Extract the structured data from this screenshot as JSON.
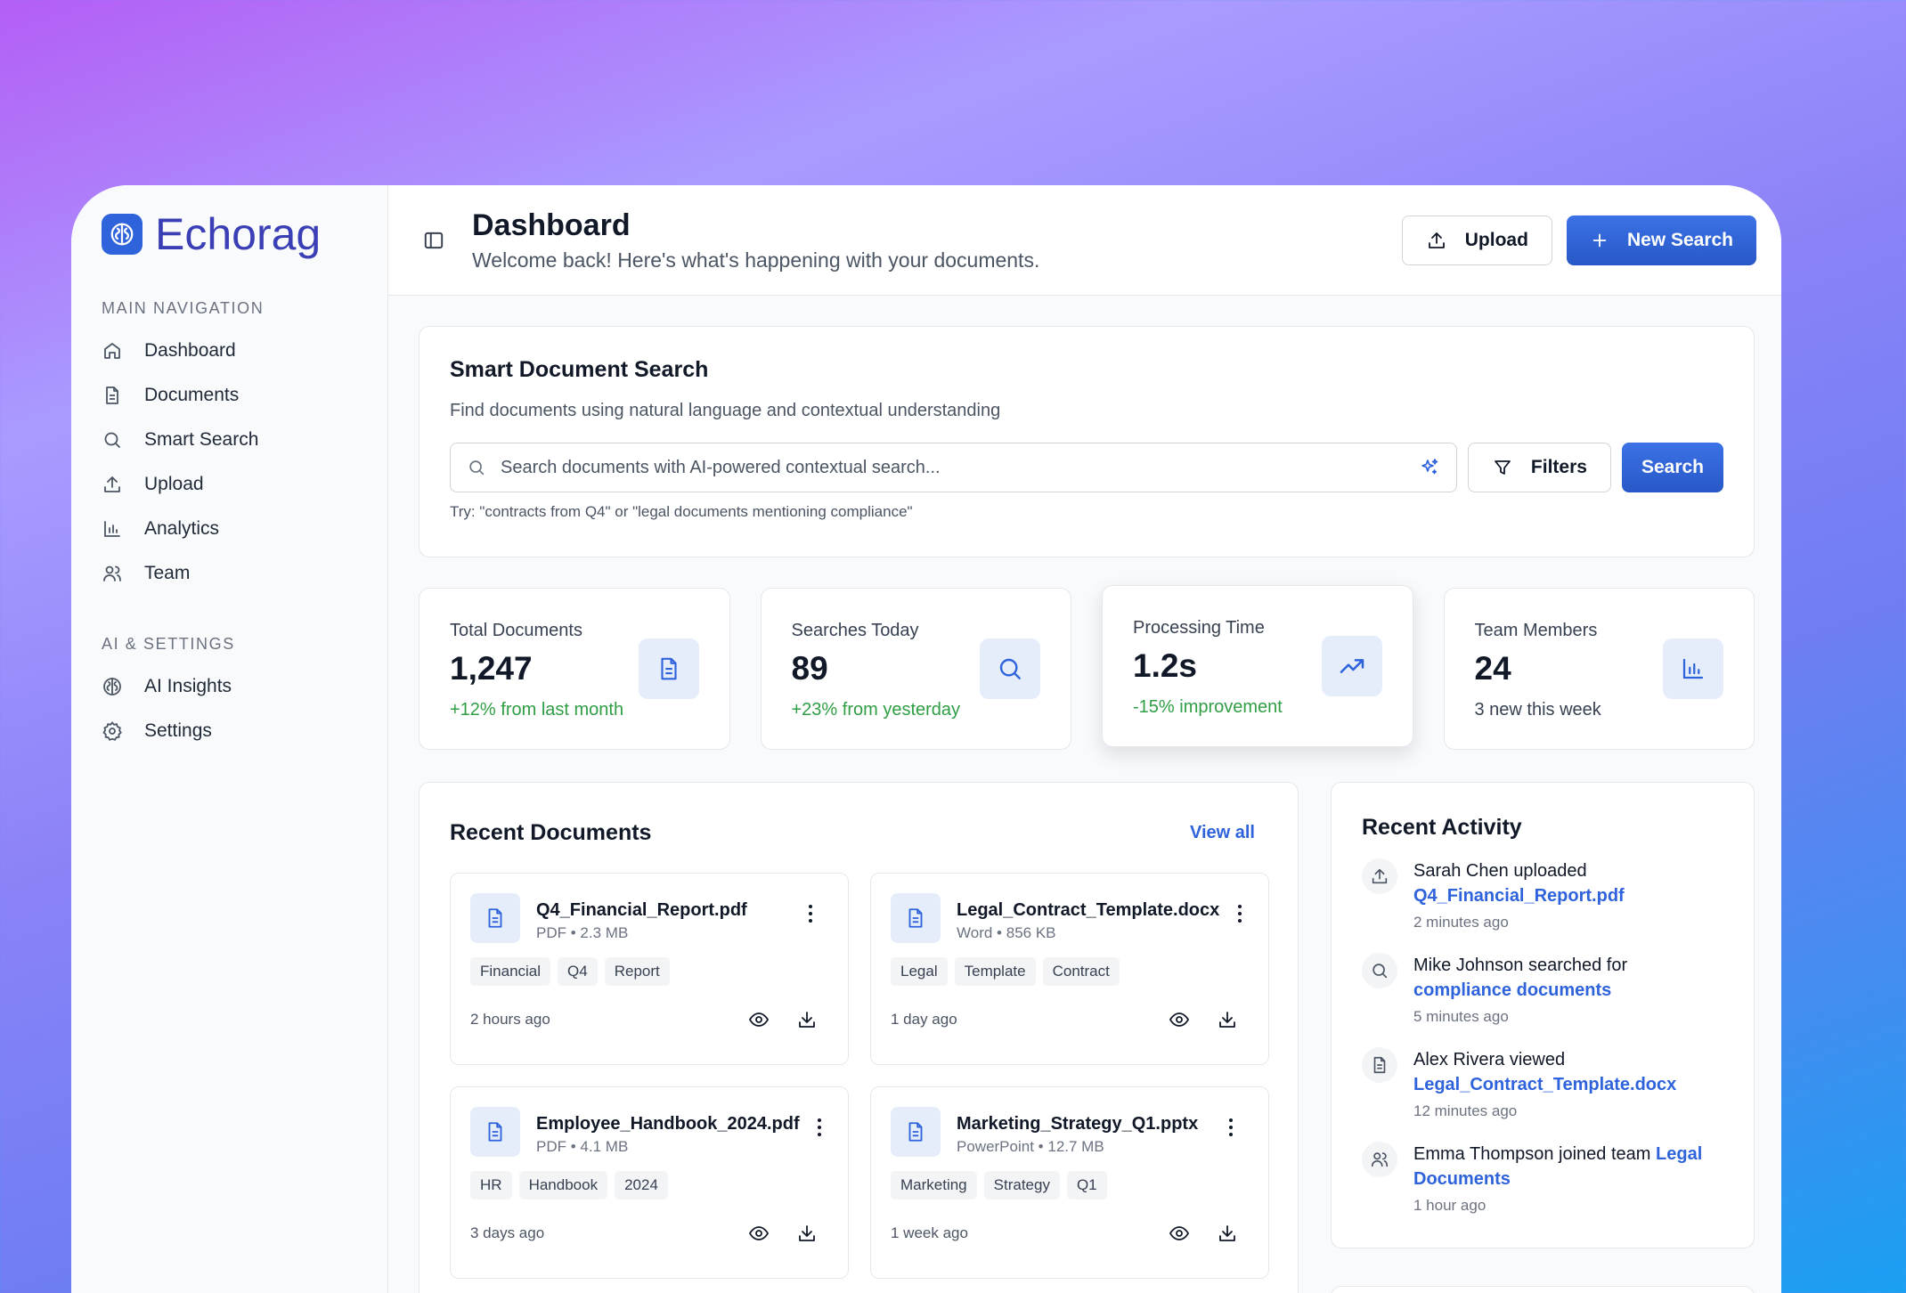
{
  "brand": {
    "name": "Echorag"
  },
  "sidebar": {
    "main_label": "MAIN NAVIGATION",
    "main_items": [
      {
        "label": "Dashboard",
        "icon": "home-icon"
      },
      {
        "label": "Documents",
        "icon": "document-icon"
      },
      {
        "label": "Smart Search",
        "icon": "search-icon"
      },
      {
        "label": "Upload",
        "icon": "upload-icon"
      },
      {
        "label": "Analytics",
        "icon": "bar-chart-icon"
      },
      {
        "label": "Team",
        "icon": "users-icon"
      }
    ],
    "settings_label": "AI & SETTINGS",
    "settings_items": [
      {
        "label": "AI Insights",
        "icon": "brain-icon"
      },
      {
        "label": "Settings",
        "icon": "gear-icon"
      }
    ]
  },
  "header": {
    "title": "Dashboard",
    "subtitle": "Welcome back! Here's what's happening with your documents.",
    "upload_label": "Upload",
    "new_search_label": "New Search"
  },
  "search": {
    "title": "Smart Document Search",
    "description": "Find documents using natural language and contextual understanding",
    "placeholder": "Search documents with AI-powered contextual search...",
    "filters_label": "Filters",
    "search_label": "Search",
    "hint": "Try: \"contracts from Q4\" or \"legal documents mentioning compliance\""
  },
  "stats": [
    {
      "label": "Total Documents",
      "value": "1,247",
      "change": "+12% from last month",
      "icon": "document-icon"
    },
    {
      "label": "Searches Today",
      "value": "89",
      "change": "+23% from yesterday",
      "icon": "search-icon"
    },
    {
      "label": "Processing Time",
      "value": "1.2s",
      "change": "-15% improvement",
      "icon": "trending-up-icon"
    },
    {
      "label": "Team Members",
      "value": "24",
      "change": "3 new this week",
      "icon": "bar-chart-icon"
    }
  ],
  "recent_documents": {
    "title": "Recent Documents",
    "view_all": "View all",
    "items": [
      {
        "name": "Q4_Financial_Report.pdf",
        "type": "PDF",
        "size": "2.3 MB",
        "tags": [
          "Financial",
          "Q4",
          "Report"
        ],
        "time": "2 hours ago"
      },
      {
        "name": "Legal_Contract_Template.docx",
        "type": "Word",
        "size": "856 KB",
        "tags": [
          "Legal",
          "Template",
          "Contract"
        ],
        "time": "1 day ago"
      },
      {
        "name": "Employee_Handbook_2024.pdf",
        "type": "PDF",
        "size": "4.1 MB",
        "tags": [
          "HR",
          "Handbook",
          "2024"
        ],
        "time": "3 days ago"
      },
      {
        "name": "Marketing_Strategy_Q1.pptx",
        "type": "PowerPoint",
        "size": "12.7 MB",
        "tags": [
          "Marketing",
          "Strategy",
          "Q1"
        ],
        "time": "1 week ago"
      }
    ],
    "meta_separator": "•"
  },
  "recent_activity": {
    "title": "Recent Activity",
    "items": [
      {
        "user": "Sarah Chen",
        "action": "uploaded",
        "target": "Q4_Financial_Report.pdf",
        "time": "2 minutes ago",
        "icon": "upload-icon"
      },
      {
        "user": "Mike Johnson",
        "action": "searched for",
        "target": "compliance documents",
        "time": "5 minutes ago",
        "icon": "search-icon"
      },
      {
        "user": "Alex Rivera",
        "action": "viewed",
        "target": "Legal_Contract_Template.docx",
        "time": "12 minutes ago",
        "icon": "document-icon"
      },
      {
        "user": "Emma Thompson",
        "action": "joined team",
        "target": "Legal Documents",
        "time": "1 hour ago",
        "icon": "users-icon"
      }
    ]
  },
  "colors": {
    "accent": "#2f63db",
    "brand_text": "#3b3fb6",
    "positive": "#2f9e44"
  }
}
